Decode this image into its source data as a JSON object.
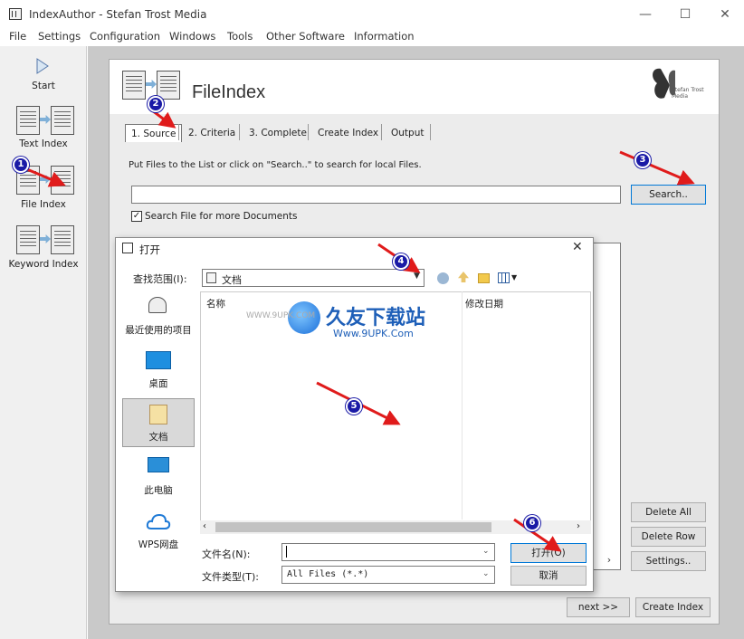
{
  "window": {
    "title": "IndexAuthor - Stefan Trost Media",
    "controls": {
      "minimize": "—",
      "maximize": "☐",
      "close": "✕"
    }
  },
  "menu": [
    "File",
    "Settings",
    "Configuration",
    "Windows",
    "Tools",
    "Other Software",
    "Information"
  ],
  "sidebar": {
    "items": [
      {
        "label": "Start",
        "icon": "play-icon"
      },
      {
        "label": "Text Index",
        "icon": "text-index-icon"
      },
      {
        "label": "File Index",
        "icon": "file-index-icon"
      },
      {
        "label": "Keyword Index",
        "icon": "keyword-index-icon"
      }
    ]
  },
  "header": {
    "title": "FileIndex",
    "logo_text": "Stefan Trost Media"
  },
  "tabs": [
    "1. Source",
    "2. Criteria",
    "3. Complete",
    "Create Index",
    "Output"
  ],
  "source": {
    "instruction": "Put Files to the List or click on \"Search..\" to search for local Files.",
    "path_value": "",
    "search_button": "Search..",
    "checkbox_label": "Search File for more Documents",
    "checkbox_checked": "✓"
  },
  "side_buttons": {
    "delete_all": "Delete All",
    "delete_row": "Delete Row",
    "settings": "Settings.."
  },
  "bottom_buttons": {
    "next": "next >>",
    "create_index": "Create Index"
  },
  "dialog": {
    "title": "打开",
    "close": "✕",
    "look_in_label": "查找范围(I):",
    "look_in_value": "文档",
    "columns": [
      "名称",
      "修改日期"
    ],
    "places": [
      {
        "label": "最近使用的项目",
        "icon": "recent-icon"
      },
      {
        "label": "桌面",
        "icon": "desktop-icon"
      },
      {
        "label": "文档",
        "icon": "documents-icon"
      },
      {
        "label": "此电脑",
        "icon": "computer-icon"
      },
      {
        "label": "WPS网盘",
        "icon": "cloud-icon"
      }
    ],
    "filename_label": "文件名(N):",
    "filename_value": "",
    "filetype_label": "文件类型(T):",
    "filetype_value": "All Files (*.*)",
    "open_button": "打开(O)",
    "cancel_button": "取消"
  },
  "watermark": {
    "main": "久友下载站",
    "url": "Www.9UPK.Com",
    "left": "WWW.9UPK.COM"
  },
  "markers": [
    "1",
    "2",
    "3",
    "4",
    "5",
    "6"
  ],
  "colors": {
    "annotation_arrow": "#e01b1b",
    "marker_fill": "#1a1aa6",
    "focus_blue": "#0078d7"
  }
}
